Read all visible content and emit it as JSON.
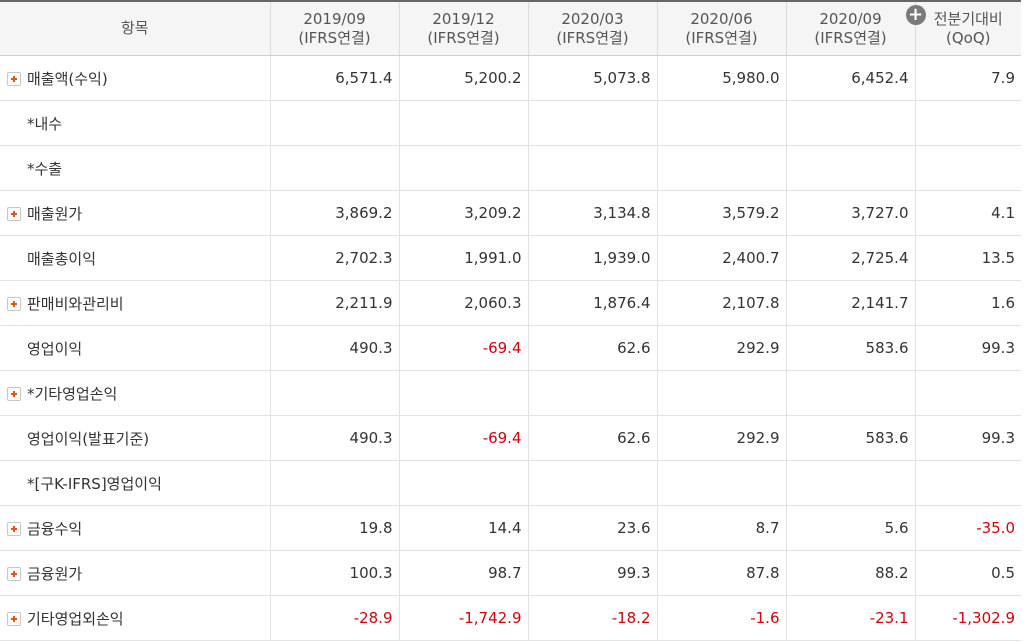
{
  "header": {
    "item_label": "항목",
    "columns": [
      {
        "line1": "2019/09",
        "line2": "(IFRS연결)"
      },
      {
        "line1": "2019/12",
        "line2": "(IFRS연결)"
      },
      {
        "line1": "2020/03",
        "line2": "(IFRS연결)"
      },
      {
        "line1": "2020/06",
        "line2": "(IFRS연결)"
      },
      {
        "line1": "2020/09",
        "line2": "(IFRS연결)"
      },
      {
        "line1": "전분기대비",
        "line2": "(QoQ)"
      }
    ],
    "add_column_icon": "plus-circle-icon"
  },
  "colors": {
    "negative": "#d4000c",
    "expander_plus": "#e8540c",
    "header_bg": "#f5f5f5"
  },
  "rows": [
    {
      "label": "매출액(수익)",
      "expandable": true,
      "values": [
        "6,571.4",
        "5,200.2",
        "5,073.8",
        "5,980.0",
        "6,452.4",
        "7.9"
      ]
    },
    {
      "label": "*내수",
      "expandable": false,
      "values": [
        "",
        "",
        "",
        "",
        "",
        ""
      ]
    },
    {
      "label": "*수출",
      "expandable": false,
      "values": [
        "",
        "",
        "",
        "",
        "",
        ""
      ]
    },
    {
      "label": "매출원가",
      "expandable": true,
      "values": [
        "3,869.2",
        "3,209.2",
        "3,134.8",
        "3,579.2",
        "3,727.0",
        "4.1"
      ]
    },
    {
      "label": "매출총이익",
      "expandable": false,
      "values": [
        "2,702.3",
        "1,991.0",
        "1,939.0",
        "2,400.7",
        "2,725.4",
        "13.5"
      ]
    },
    {
      "label": "판매비와관리비",
      "expandable": true,
      "values": [
        "2,211.9",
        "2,060.3",
        "1,876.4",
        "2,107.8",
        "2,141.7",
        "1.6"
      ]
    },
    {
      "label": "영업이익",
      "expandable": false,
      "values": [
        "490.3",
        "-69.4",
        "62.6",
        "292.9",
        "583.6",
        "99.3"
      ]
    },
    {
      "label": "*기타영업손익",
      "expandable": true,
      "values": [
        "",
        "",
        "",
        "",
        "",
        ""
      ]
    },
    {
      "label": "영업이익(발표기준)",
      "expandable": false,
      "values": [
        "490.3",
        "-69.4",
        "62.6",
        "292.9",
        "583.6",
        "99.3"
      ]
    },
    {
      "label": "*[구K-IFRS]영업이익",
      "expandable": false,
      "values": [
        "",
        "",
        "",
        "",
        "",
        ""
      ]
    },
    {
      "label": "금융수익",
      "expandable": true,
      "values": [
        "19.8",
        "14.4",
        "23.6",
        "8.7",
        "5.6",
        "-35.0"
      ]
    },
    {
      "label": "금융원가",
      "expandable": true,
      "values": [
        "100.3",
        "98.7",
        "99.3",
        "87.8",
        "88.2",
        "0.5"
      ]
    },
    {
      "label": "기타영업외손익",
      "expandable": true,
      "values": [
        "-28.9",
        "-1,742.9",
        "-18.2",
        "-1.6",
        "-23.1",
        "-1,302.9"
      ]
    }
  ]
}
